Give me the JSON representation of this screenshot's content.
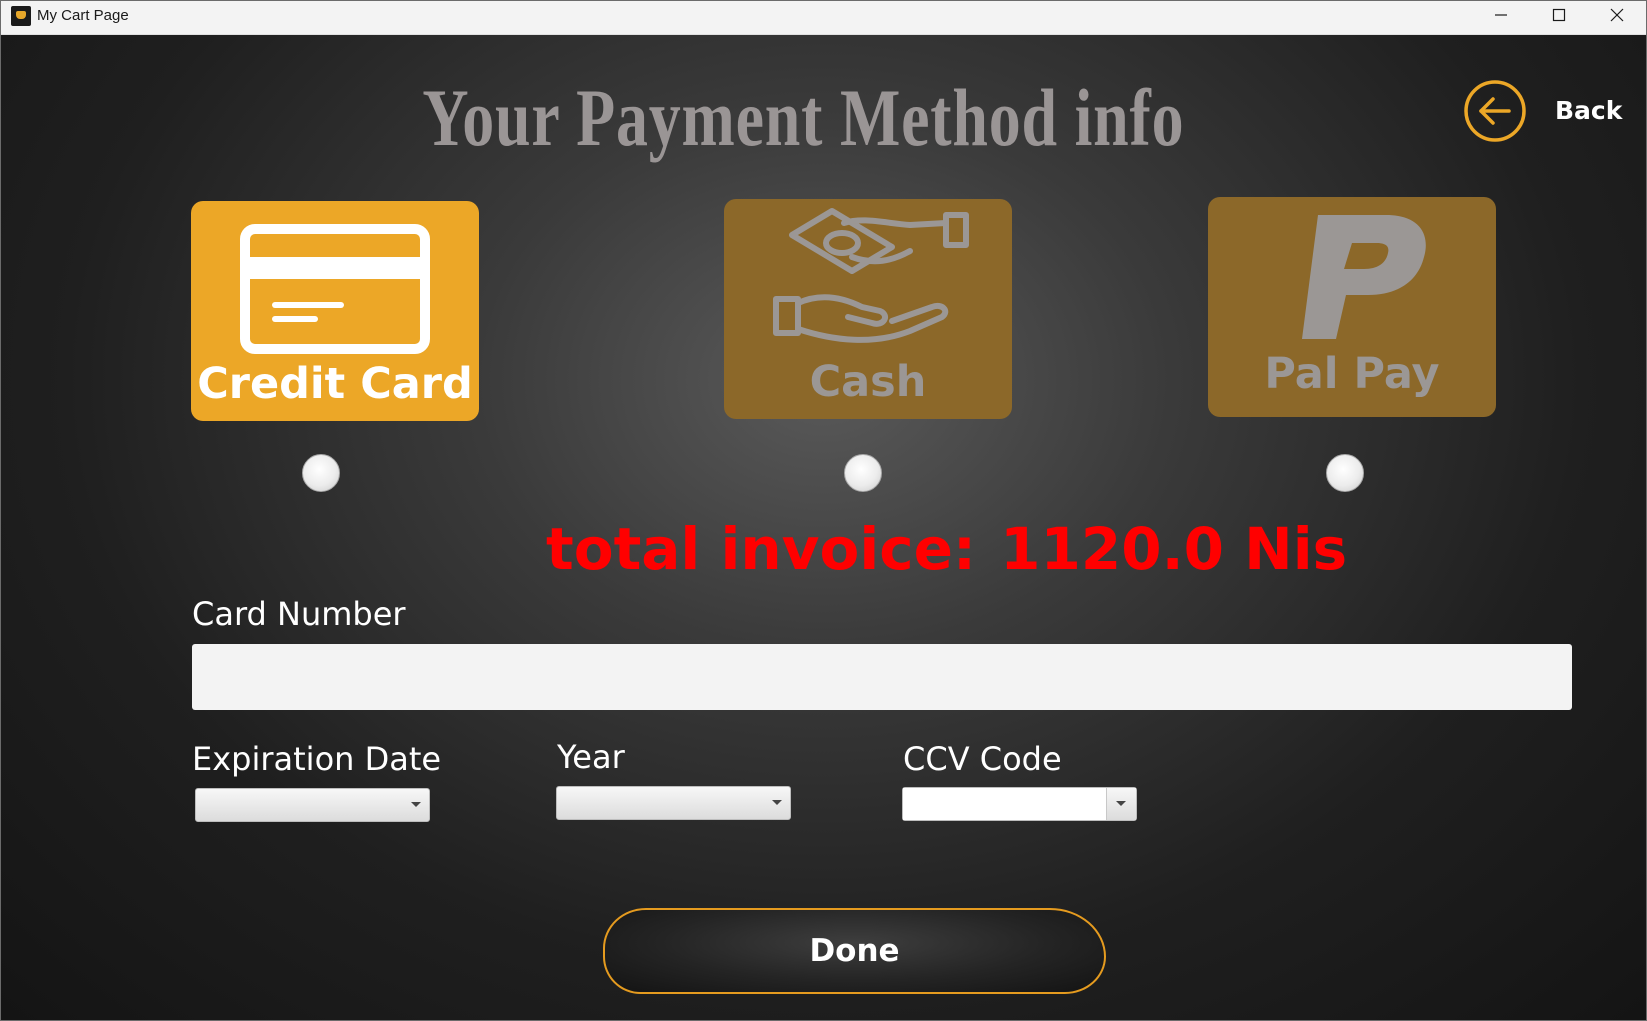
{
  "window": {
    "title": "My Cart Page",
    "controls": [
      "minimize",
      "maximize",
      "close"
    ]
  },
  "header": {
    "title": "Your Payment Method info",
    "back_label": "Back",
    "back_icon": "arrow-left-circle-icon"
  },
  "payment_methods": [
    {
      "label": "Credit Card",
      "icon": "credit-card-icon",
      "selected_style": true
    },
    {
      "label": "Cash",
      "icon": "cash-hand-icon",
      "selected_style": false
    },
    {
      "label": "Pal Pay",
      "icon": "paypal-p-icon",
      "selected_style": false
    }
  ],
  "invoice": {
    "label": "total invoice:",
    "amount": "1120.0 Nis"
  },
  "form": {
    "card_number_label": "Card Number",
    "card_number_value": "",
    "expiration_label": "Expiration Date",
    "expiration_value": "",
    "year_label": "Year",
    "year_value": "",
    "ccv_label": "CCV Code",
    "ccv_value": ""
  },
  "actions": {
    "done_label": "Done"
  },
  "colors": {
    "accent": "#eca727",
    "accent_dim": "#8c6829",
    "invoice": "#ff0000",
    "title": "#9a9595"
  }
}
